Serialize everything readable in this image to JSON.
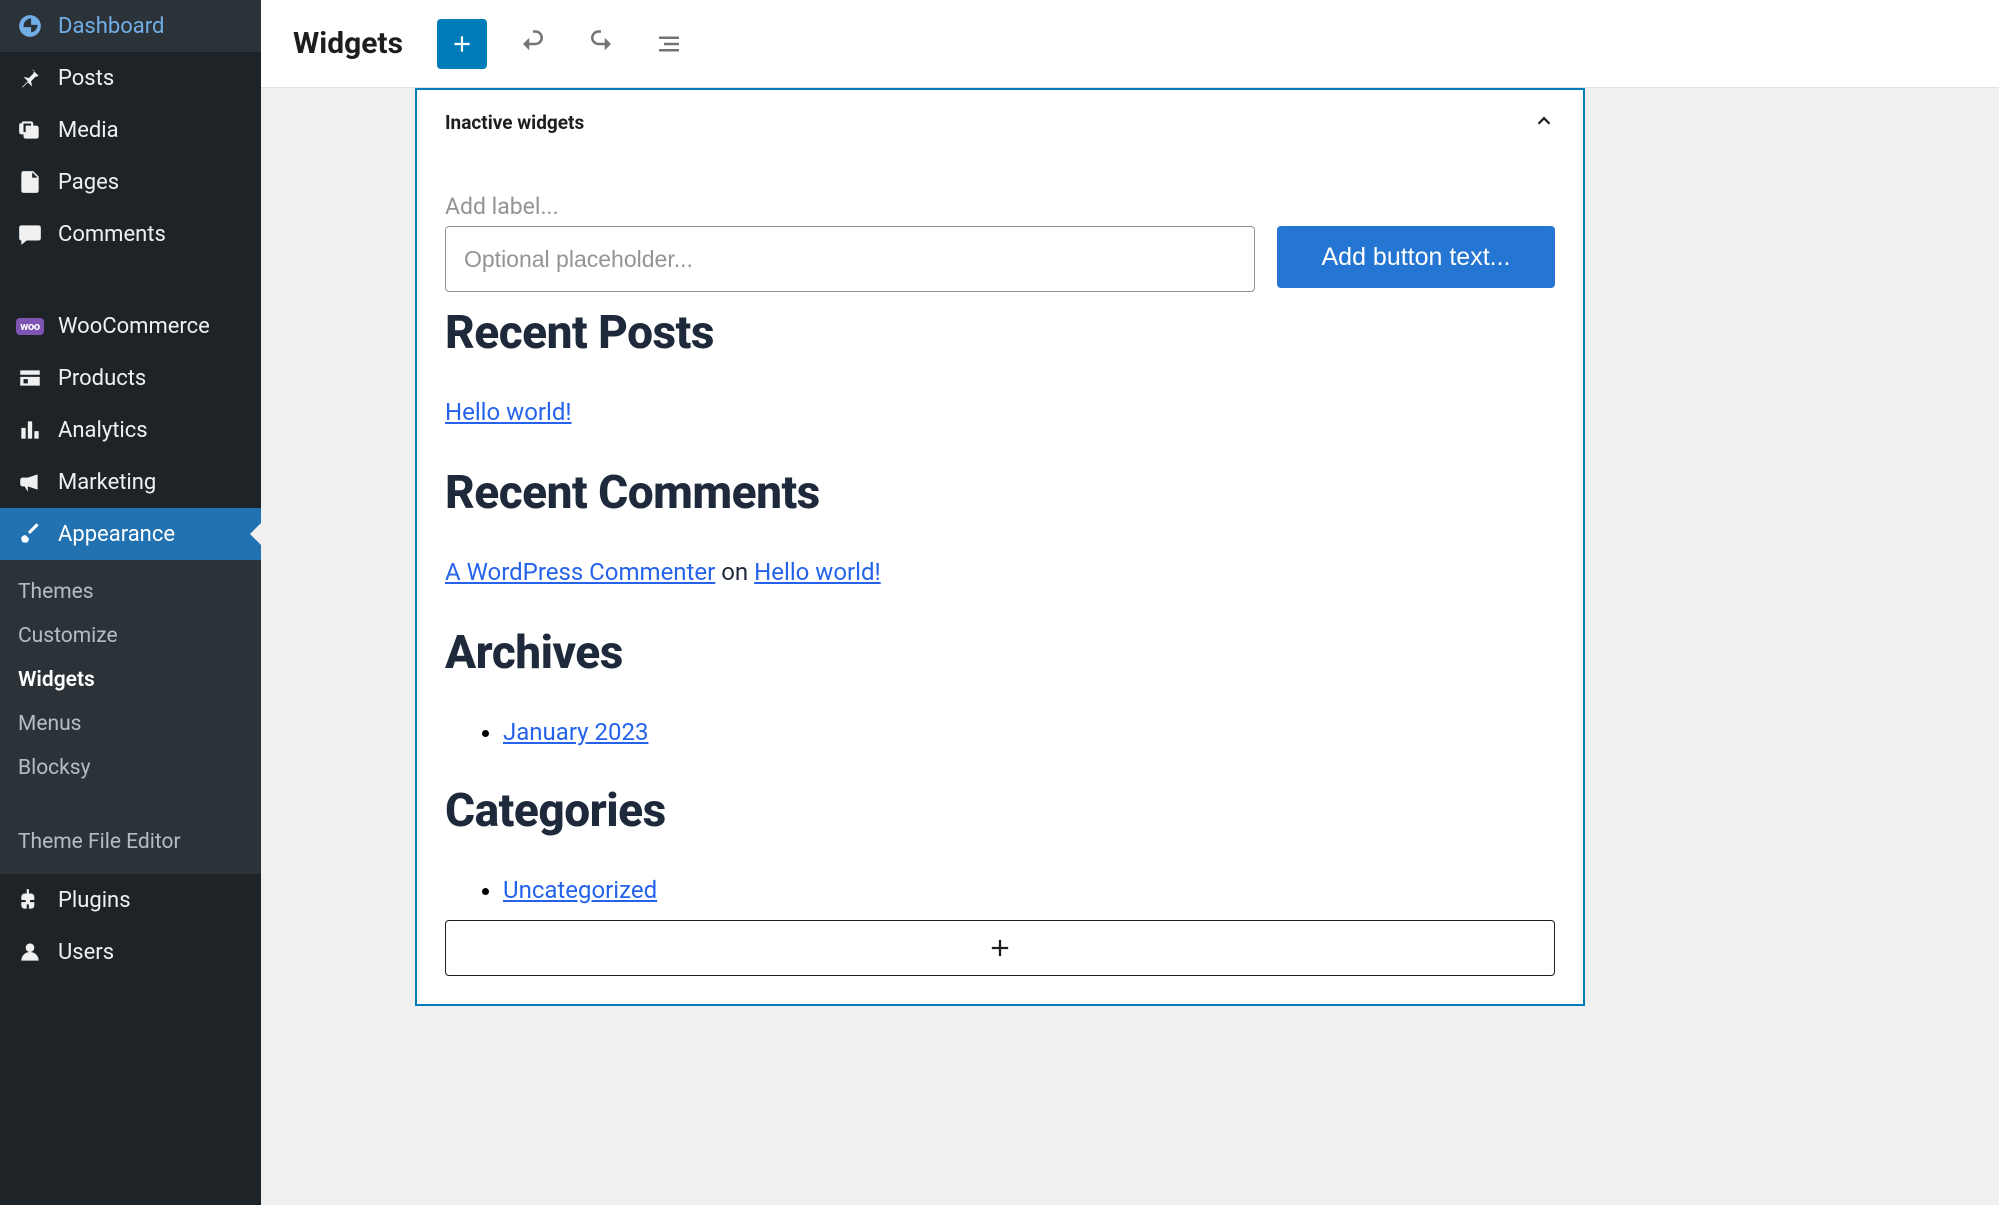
{
  "sidebar": {
    "items": [
      {
        "label": "Dashboard",
        "icon": "dashboard"
      },
      {
        "label": "Posts",
        "icon": "pin"
      },
      {
        "label": "Media",
        "icon": "media"
      },
      {
        "label": "Pages",
        "icon": "pages"
      },
      {
        "label": "Comments",
        "icon": "comments"
      },
      {
        "label": "WooCommerce",
        "icon": "woo"
      },
      {
        "label": "Products",
        "icon": "products"
      },
      {
        "label": "Analytics",
        "icon": "analytics"
      },
      {
        "label": "Marketing",
        "icon": "marketing"
      },
      {
        "label": "Appearance",
        "icon": "appearance",
        "active": true
      },
      {
        "label": "Plugins",
        "icon": "plugins"
      },
      {
        "label": "Users",
        "icon": "users"
      }
    ],
    "submenu": {
      "items": [
        {
          "label": "Themes"
        },
        {
          "label": "Customize"
        },
        {
          "label": "Widgets",
          "current": true
        },
        {
          "label": "Menus"
        },
        {
          "label": "Blocksy"
        }
      ],
      "bottom": [
        {
          "label": "Theme File Editor"
        }
      ]
    }
  },
  "topbar": {
    "title": "Widgets"
  },
  "panel": {
    "title": "Inactive widgets",
    "label_placeholder": "Add label...",
    "input_placeholder": "Optional placeholder...",
    "button_placeholder": "Add button text...",
    "recent_posts": {
      "heading": "Recent Posts",
      "items": [
        {
          "title": "Hello world!"
        }
      ]
    },
    "recent_comments": {
      "heading": "Recent Comments",
      "items": [
        {
          "author": "A WordPress Commenter",
          "connector": " on ",
          "post": "Hello world!"
        }
      ]
    },
    "archives": {
      "heading": "Archives",
      "items": [
        {
          "label": "January 2023"
        }
      ]
    },
    "categories": {
      "heading": "Categories",
      "items": [
        {
          "label": "Uncategorized"
        }
      ]
    }
  }
}
